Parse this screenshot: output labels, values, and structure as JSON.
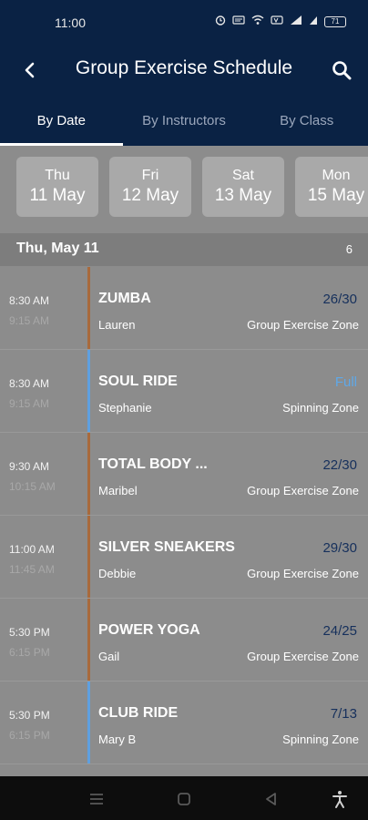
{
  "status_bar": {
    "time": "11:00",
    "battery": "71"
  },
  "header": {
    "title": "Group Exercise Schedule",
    "back_icon": "back-arrow-icon",
    "search_icon": "search-icon"
  },
  "tabs": [
    {
      "label": "By Date",
      "active": true
    },
    {
      "label": "By Instructors",
      "active": false
    },
    {
      "label": "By Class",
      "active": false
    }
  ],
  "dates": [
    {
      "dow": "Thu",
      "dom": "11 May"
    },
    {
      "dow": "Fri",
      "dom": "12 May"
    },
    {
      "dow": "Sat",
      "dom": "13 May"
    },
    {
      "dow": "Mon",
      "dom": "15 May"
    }
  ],
  "section": {
    "title": "Thu, May 11",
    "count": "6"
  },
  "classes": [
    {
      "start": "8:30 AM",
      "end": "9:15 AM",
      "name": "ZUMBA",
      "capacity": "26/30",
      "instructor": "Lauren",
      "zone": "Group Exercise Zone",
      "bar_color": "#a86a3c"
    },
    {
      "start": "8:30 AM",
      "end": "9:15 AM",
      "name": "SOUL RIDE",
      "capacity": "Full",
      "instructor": "Stephanie",
      "zone": "Spinning Zone",
      "bar_color": "#5fa0e0"
    },
    {
      "start": "9:30 AM",
      "end": "10:15 AM",
      "name": "TOTAL BODY ...",
      "capacity": "22/30",
      "instructor": "Maribel",
      "zone": "Group Exercise Zone",
      "bar_color": "#a86a3c"
    },
    {
      "start": "11:00 AM",
      "end": "11:45 AM",
      "name": "SILVER SNEAKERS",
      "capacity": "29/30",
      "instructor": "Debbie",
      "zone": "Group Exercise Zone",
      "bar_color": "#a86a3c"
    },
    {
      "start": "5:30 PM",
      "end": "6:15 PM",
      "name": "POWER YOGA",
      "capacity": "24/25",
      "instructor": "Gail",
      "zone": "Group Exercise Zone",
      "bar_color": "#a86a3c"
    },
    {
      "start": "5:30 PM",
      "end": "6:15 PM",
      "name": "CLUB RIDE",
      "capacity": "7/13",
      "instructor": "Mary B",
      "zone": "Spinning Zone",
      "bar_color": "#5fa0e0"
    }
  ],
  "nav": {
    "recents_icon": "recents-menu-icon",
    "home_icon": "home-square-icon",
    "back_icon": "back-triangle-icon",
    "accessibility_icon": "accessibility-icon"
  },
  "colors": {
    "header_bg": "#0a2244",
    "list_bg": "#8c8c8c",
    "capacity_text": "#16305c",
    "full_text": "#5fa8e8"
  }
}
